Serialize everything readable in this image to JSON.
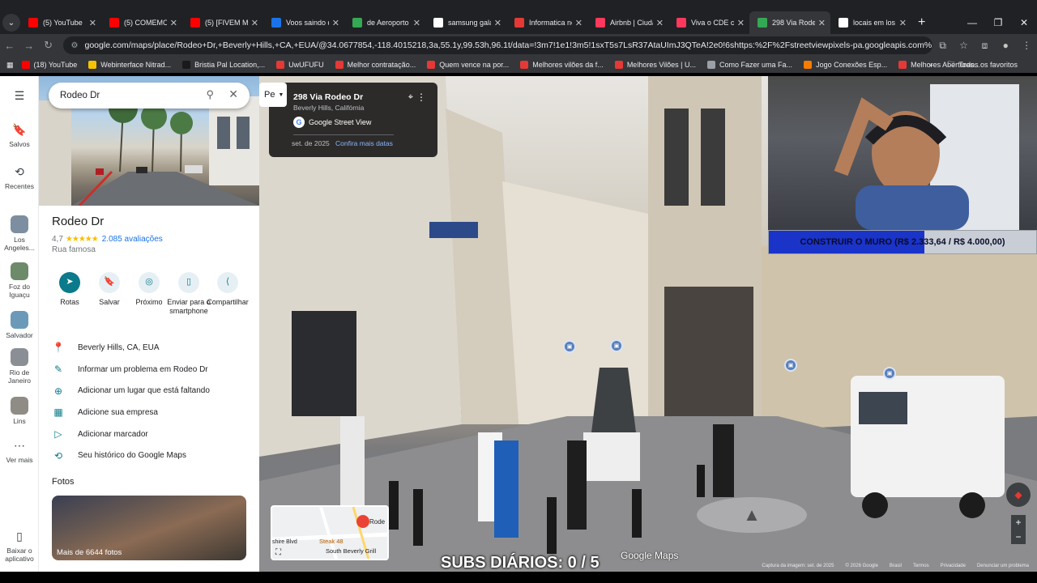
{
  "browser": {
    "tabs": [
      {
        "title": "(5) YouTube",
        "color": "#ff0000",
        "active": false
      },
      {
        "title": "(5) COMEMOS",
        "color": "#ff0000",
        "active": false
      },
      {
        "title": "(5) [FIVEM MA",
        "color": "#ff0000",
        "active": false
      },
      {
        "title": "Voos saindo d",
        "color": "#1a73e8",
        "active": false
      },
      {
        "title": "de Aeroporto I",
        "color": "#34a853",
        "active": false
      },
      {
        "title": "samsung gala",
        "color": "#ffffff",
        "active": false
      },
      {
        "title": "Informatica no",
        "color": "#e53935",
        "active": false
      },
      {
        "title": "Airbnb | Ciuda",
        "color": "#ff385c",
        "active": false
      },
      {
        "title": "Viva o CDE co",
        "color": "#ff385c",
        "active": false
      },
      {
        "title": "298 Via Rodeo",
        "color": "#34a853",
        "active": true
      },
      {
        "title": "locais em los a",
        "color": "#ffffff",
        "active": false
      }
    ],
    "url": "google.com/maps/place/Rodeo+Dr,+Beverly+Hills,+CA,+EUA/@34.0677854,-118.4015218,3a,55.1y,99.53h,96.1t/data=!3m7!1e1!3m5!1sxT5s7LsR37AtaUImJ3QTeA!2e0!6shttps:%2F%2Fstreetviewpixels-pa.googleapis.com%2Fv1%2Fthumbnail%3Fcb_cli...",
    "bookmarks": [
      {
        "label": "(18) YouTube",
        "color": "#ff0000"
      },
      {
        "label": "Webinterface Nitrad...",
        "color": "#f5c400"
      },
      {
        "label": "Bristia Pal Location,...",
        "color": "#1a1a1a"
      },
      {
        "label": "UwUFUFU",
        "color": "#e53935"
      },
      {
        "label": "Melhor contratação...",
        "color": "#e53935"
      },
      {
        "label": "Quem vence na por...",
        "color": "#e53935"
      },
      {
        "label": "Melhores vilões da f...",
        "color": "#e53935"
      },
      {
        "label": "Melhores Vilões | U...",
        "color": "#e53935"
      },
      {
        "label": "Como Fazer uma Fa...",
        "color": "#9aa0a6"
      },
      {
        "label": "Jogo Conexões Esp...",
        "color": "#f57c00"
      },
      {
        "label": "Melhores Aberturas...",
        "color": "#e53935"
      }
    ],
    "all_bookmarks": "Todos os favoritos"
  },
  "rail": {
    "items": [
      {
        "label": "Salvos",
        "icon": "bookmark-icon",
        "glyph": "🔖"
      },
      {
        "label": "Recentes",
        "icon": "history-icon",
        "glyph": "⟲"
      },
      {
        "label": "Los Angeles...",
        "icon": "thumb",
        "color": "#7d8ea0"
      },
      {
        "label": "Foz do Iguaçu",
        "icon": "thumb",
        "color": "#6d8a6a"
      },
      {
        "label": "Salvador",
        "icon": "thumb",
        "color": "#6b9ab8"
      },
      {
        "label": "Rio de Janeiro",
        "icon": "thumb",
        "color": "#8a8f96"
      },
      {
        "label": "Lins",
        "icon": "thumb",
        "color": "#8f8c86"
      },
      {
        "label": "Ver mais",
        "icon": "more-icon",
        "glyph": "⋯"
      }
    ],
    "download": "Baixar o aplicativo"
  },
  "panel": {
    "search_value": "Rodeo Dr",
    "title": "Rodeo Dr",
    "rating": "4,7",
    "stars": "★★★★★",
    "reviews": "2.085 avaliações",
    "type": "Rua famosa",
    "actions": [
      {
        "label": "Rotas",
        "glyph": "➤"
      },
      {
        "label": "Salvar",
        "glyph": "🔖"
      },
      {
        "label": "Próximo",
        "glyph": "◎"
      },
      {
        "label": "Enviar para o smartphone",
        "glyph": "▯"
      },
      {
        "label": "Compartilhar",
        "glyph": "⟨"
      }
    ],
    "info": [
      {
        "text": "Beverly Hills, CA, EUA",
        "glyph": "📍"
      },
      {
        "text": "Informar um problema em Rodeo Dr",
        "glyph": "✎"
      },
      {
        "text": "Adicionar um lugar que está faltando",
        "glyph": "⊕"
      },
      {
        "text": "Adicione sua empresa",
        "glyph": "▦"
      },
      {
        "text": "Adicionar marcador",
        "glyph": "▷"
      },
      {
        "text": "Seu histórico do Google Maps",
        "glyph": "⟲"
      }
    ],
    "photos_label": "Fotos",
    "photos_more": "Mais de 6644 fotos"
  },
  "streetview": {
    "card_pill": "Pe",
    "address": "298 Via Rodeo Dr",
    "city": "Beverly Hills, Califórnia",
    "source": "Google Street View",
    "date": "set. de 2025",
    "more_dates": "Confira mais datas",
    "minimap_labels": [
      "Rode",
      "shire Blvd",
      "Steak 48",
      "South Beverly Grill"
    ],
    "subs": "SUBS DIÁRIOS: 0 / 5",
    "logo": "Google Maps",
    "footer": [
      "Captura da imagem: set. de 2025",
      "© 2026 Google",
      "Brasil",
      "Termos",
      "Privacidade",
      "Denunciar um problema"
    ],
    "store_sign": "STEFANO RICCI"
  },
  "overlay": {
    "progress_text": "CONSTRUIR O MURO (R$ 2.333,64 / R$ 4.000,00)",
    "progress_value": 0.583
  }
}
